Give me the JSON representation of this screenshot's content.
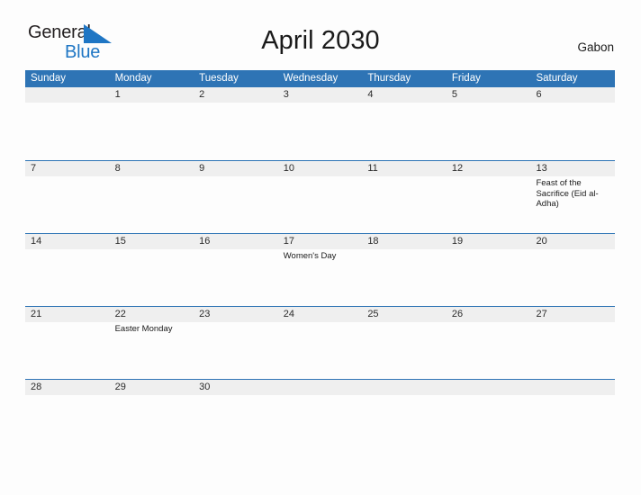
{
  "brand": {
    "name_part1": "General",
    "name_part2": "Blue",
    "triangle_icon": "blue-right-triangle",
    "primary_color": "#2e74b5",
    "accent_color": "#1f76c4"
  },
  "header": {
    "title": "April 2030",
    "country": "Gabon"
  },
  "calendar": {
    "weekday_headers": [
      "Sunday",
      "Monday",
      "Tuesday",
      "Wednesday",
      "Thursday",
      "Friday",
      "Saturday"
    ],
    "header_bg_color": "#2e74b5",
    "daynum_band_color": "#efefef",
    "row_divider_color": "#2e74b5",
    "weeks": [
      {
        "days": [
          {
            "number": "",
            "events": []
          },
          {
            "number": "1",
            "events": []
          },
          {
            "number": "2",
            "events": []
          },
          {
            "number": "3",
            "events": []
          },
          {
            "number": "4",
            "events": []
          },
          {
            "number": "5",
            "events": []
          },
          {
            "number": "6",
            "events": []
          }
        ]
      },
      {
        "days": [
          {
            "number": "7",
            "events": []
          },
          {
            "number": "8",
            "events": []
          },
          {
            "number": "9",
            "events": []
          },
          {
            "number": "10",
            "events": []
          },
          {
            "number": "11",
            "events": []
          },
          {
            "number": "12",
            "events": []
          },
          {
            "number": "13",
            "events": [
              "Feast of the Sacrifice (Eid al-Adha)"
            ]
          }
        ]
      },
      {
        "days": [
          {
            "number": "14",
            "events": []
          },
          {
            "number": "15",
            "events": []
          },
          {
            "number": "16",
            "events": []
          },
          {
            "number": "17",
            "events": [
              "Women's Day"
            ]
          },
          {
            "number": "18",
            "events": []
          },
          {
            "number": "19",
            "events": []
          },
          {
            "number": "20",
            "events": []
          }
        ]
      },
      {
        "days": [
          {
            "number": "21",
            "events": []
          },
          {
            "number": "22",
            "events": [
              "Easter Monday"
            ]
          },
          {
            "number": "23",
            "events": []
          },
          {
            "number": "24",
            "events": []
          },
          {
            "number": "25",
            "events": []
          },
          {
            "number": "26",
            "events": []
          },
          {
            "number": "27",
            "events": []
          }
        ]
      },
      {
        "days": [
          {
            "number": "28",
            "events": []
          },
          {
            "number": "29",
            "events": []
          },
          {
            "number": "30",
            "events": []
          },
          {
            "number": "",
            "events": []
          },
          {
            "number": "",
            "events": []
          },
          {
            "number": "",
            "events": []
          },
          {
            "number": "",
            "events": []
          }
        ]
      }
    ]
  }
}
